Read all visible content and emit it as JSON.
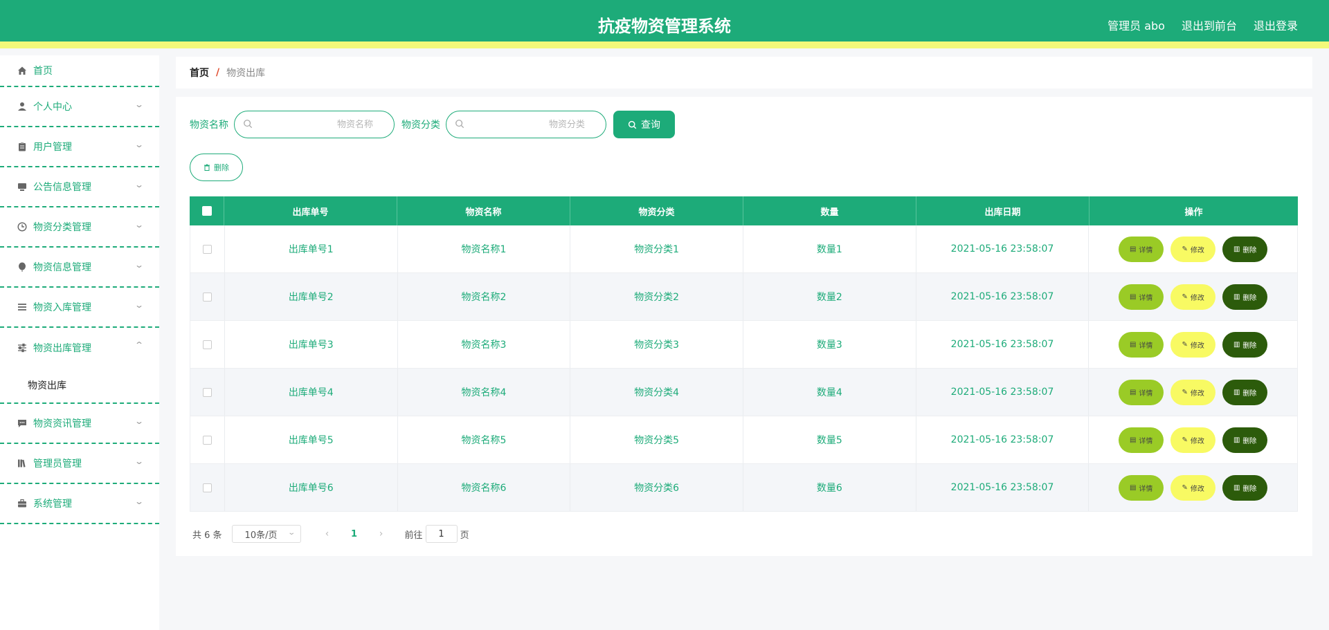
{
  "header": {
    "title": "抗疫物资管理系统",
    "admin": "管理员 abo",
    "to_front": "退出到前台",
    "logout": "退出登录"
  },
  "sidebar": {
    "items": [
      {
        "label": "首页",
        "icon": "home-icon"
      },
      {
        "label": "个人中心",
        "icon": "user-icon"
      },
      {
        "label": "用户管理",
        "icon": "clipboard-icon"
      },
      {
        "label": "公告信息管理",
        "icon": "monitor-icon"
      },
      {
        "label": "物资分类管理",
        "icon": "clock-icon"
      },
      {
        "label": "物资信息管理",
        "icon": "balloon-icon"
      },
      {
        "label": "物资入库管理",
        "icon": "list-icon"
      },
      {
        "label": "物资出库管理",
        "icon": "sliders-icon"
      },
      {
        "label": "物资资讯管理",
        "icon": "chat-icon"
      },
      {
        "label": "管理员管理",
        "icon": "books-icon"
      },
      {
        "label": "系统管理",
        "icon": "briefcase-icon"
      }
    ],
    "open_submenu": "物资出库"
  },
  "breadcrumb": {
    "home": "首页",
    "sep": "/",
    "current": "物资出库"
  },
  "search": {
    "name_label": "物资名称",
    "name_placeholder": "物资名称",
    "cat_label": "物资分类",
    "cat_placeholder": "物资分类",
    "query": "查询"
  },
  "toolbar": {
    "delete": "删除"
  },
  "table": {
    "headers": [
      "出库单号",
      "物资名称",
      "物资分类",
      "数量",
      "出库日期",
      "操作"
    ],
    "rows": [
      [
        "出库单号1",
        "物资名称1",
        "物资分类1",
        "数量1",
        "2021-05-16 23:58:07"
      ],
      [
        "出库单号2",
        "物资名称2",
        "物资分类2",
        "数量2",
        "2021-05-16 23:58:07"
      ],
      [
        "出库单号3",
        "物资名称3",
        "物资分类3",
        "数量3",
        "2021-05-16 23:58:07"
      ],
      [
        "出库单号4",
        "物资名称4",
        "物资分类4",
        "数量4",
        "2021-05-16 23:58:07"
      ],
      [
        "出库单号5",
        "物资名称5",
        "物资分类5",
        "数量5",
        "2021-05-16 23:58:07"
      ],
      [
        "出库单号6",
        "物资名称6",
        "物资分类6",
        "数量6",
        "2021-05-16 23:58:07"
      ]
    ],
    "actions": {
      "detail": "详情",
      "edit": "修改",
      "delete": "删除"
    }
  },
  "pager": {
    "total": "共 6 条",
    "page_size": "10条/页",
    "current_page": "1",
    "goto_prefix": "前往",
    "goto_value": "1",
    "goto_suffix": "页"
  },
  "colors": {
    "primary": "#1dab79",
    "stripe": "#f3f97a",
    "detail": "#9acb26",
    "edit": "#f8fa63",
    "delete": "#2c5b0b",
    "breadcrumb_sep": "#e04c2e"
  }
}
